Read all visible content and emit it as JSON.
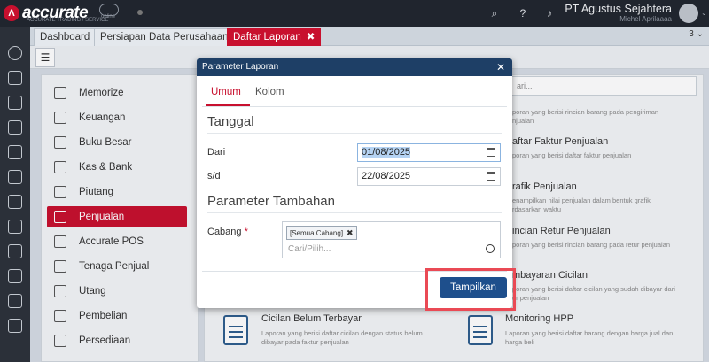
{
  "app": {
    "logo_text": "accurate",
    "logo_subtitle": "ACCURATE TRADING / SERVICE",
    "logo_online": "online",
    "company": "PT Agustus Sejahtera",
    "user": "Michel Aprilaaaa"
  },
  "tabs": [
    {
      "label": "Dashboard"
    },
    {
      "label": "Persiapan Data Perusahaan"
    },
    {
      "label": "Daftar Laporan",
      "close": "✖"
    }
  ],
  "tab_overflow": "3 ⌄",
  "menu": [
    {
      "label": "Memorize"
    },
    {
      "label": "Keuangan"
    },
    {
      "label": "Buku Besar"
    },
    {
      "label": "Kas & Bank"
    },
    {
      "label": "Piutang"
    },
    {
      "label": "Penjualan"
    },
    {
      "label": "Accurate POS"
    },
    {
      "label": "Tenaga Penjual"
    },
    {
      "label": "Utang"
    },
    {
      "label": "Pembelian"
    },
    {
      "label": "Persediaan"
    }
  ],
  "content": {
    "search_placeholder": "ari...",
    "reports": [
      {
        "title": "",
        "desc1": "poran yang berisi rincian barang pada pengiriman",
        "desc2": "njualan"
      },
      {
        "title": "aftar Faktur Penjualan",
        "desc1": "poran yang berisi daftar faktur penjualan",
        "desc2": ""
      },
      {
        "title": "rafik Penjualan",
        "desc1": "enampilkan nilai penjualan dalam bentuk grafik",
        "desc2": "rdasarkan waktu"
      },
      {
        "title": "incian Retur Penjualan",
        "desc1": "poran yang berisi rincian barang pada retur penjualan",
        "desc2": ""
      },
      {
        "title": "mbayaran Cicilan",
        "desc1": "poran yang berisi daftar cicilan yang sudah dibayar dari",
        "desc2": "ur penjualan"
      },
      {
        "title": "Cicilan Belum Terbayar",
        "desc1": "Laporan yang berisi daftar cicilan dengan status belum",
        "desc2": "dibayar pada faktur penjualan"
      },
      {
        "title": "Monitoring HPP",
        "desc1": "Laporan yang berisi daftar barang dengan harga jual dan",
        "desc2": "harga beli"
      }
    ]
  },
  "modal": {
    "title": "Parameter Laporan",
    "close": "✕",
    "tabs": [
      "Umum",
      "Kolom"
    ],
    "section_date": "Tanggal",
    "from_label": "Dari",
    "from_value": "01/08/2025",
    "to_label": "s/d",
    "to_value": "22/08/2025",
    "section_extra": "Parameter Tambahan",
    "branch_label": "Cabang",
    "branch_required": "*",
    "branch_chip": "[Semua Cabang]",
    "branch_chip_x": "✖",
    "branch_placeholder": "Cari/Pilih...",
    "submit": "Tampilkan"
  },
  "colors": {
    "accent": "#c8102e",
    "header": "#1e3f66",
    "primary_button": "#1e4f8c",
    "highlight": "#ea4a55"
  }
}
